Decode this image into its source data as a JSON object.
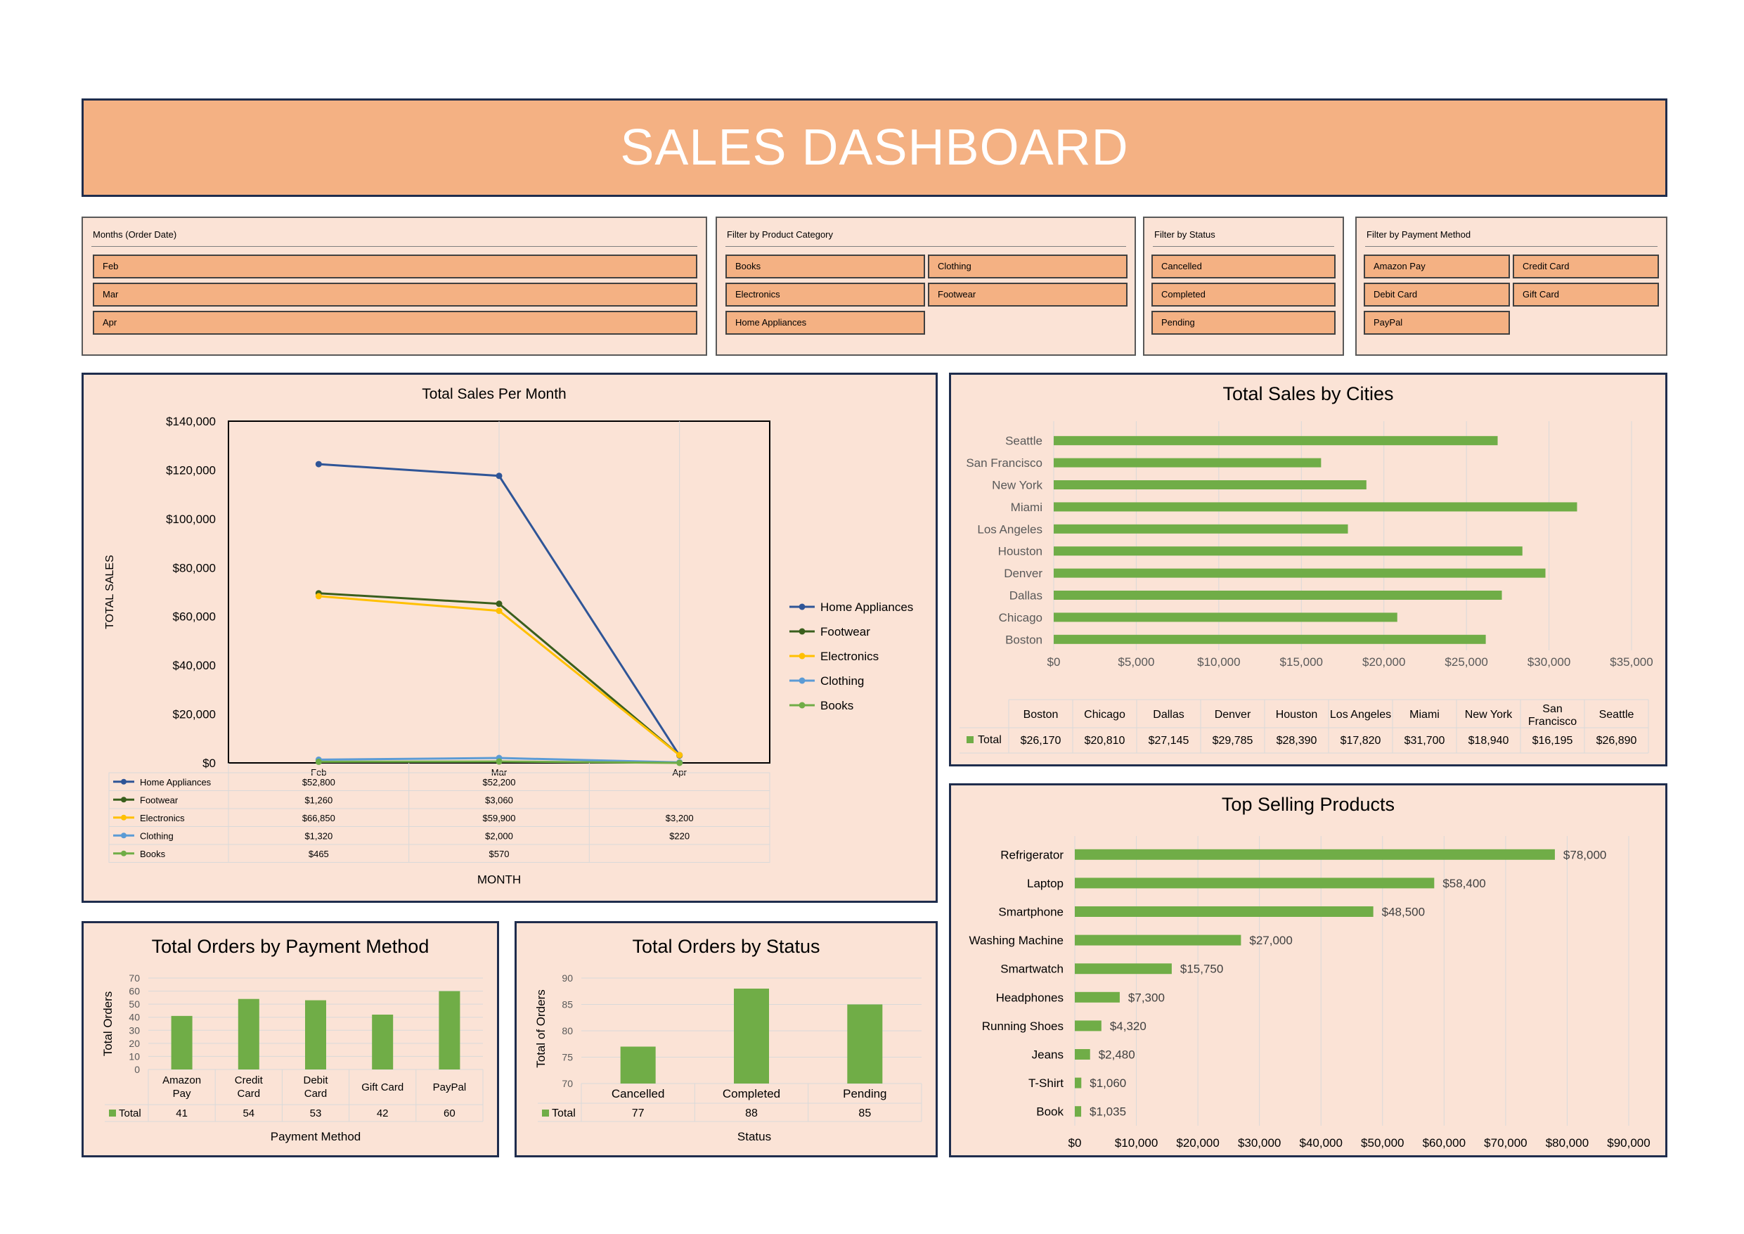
{
  "title": "SALES DASHBOARD",
  "colors": {
    "banner": "#f4b183",
    "panel_bg": "#fbe3d6",
    "panel_border": "#1f2d4d",
    "bar_green": "#70ad47"
  },
  "slicers": {
    "months": {
      "label": "Months (Order Date)",
      "items": [
        "Feb",
        "Mar",
        "Apr"
      ]
    },
    "category": {
      "label": "Filter by Product Category",
      "items": [
        "Books",
        "Clothing",
        "Electronics",
        "Footwear",
        "Home Appliances"
      ]
    },
    "status": {
      "label": "Filter by Status",
      "items": [
        "Cancelled",
        "Completed",
        "Pending"
      ]
    },
    "payment": {
      "label": "Filter by Payment Method",
      "items": [
        "Amazon Pay",
        "Credit Card",
        "Debit Card",
        "Gift Card",
        "PayPal"
      ]
    }
  },
  "chart_data": [
    {
      "type": "line",
      "title": "Total Sales Per Month",
      "xlabel": "MONTH",
      "ylabel": "TOTAL SALES",
      "categories": [
        "Feb",
        "Mar",
        "Apr"
      ],
      "ylim": [
        0,
        140000
      ],
      "yticks": [
        "$0",
        "$20,000",
        "$40,000",
        "$60,000",
        "$80,000",
        "$100,000",
        "$120,000",
        "$140,000"
      ],
      "legend_position": "right",
      "series": [
        {
          "name": "Home Appliances",
          "color": "#2f5597",
          "values": [
            122400,
            117600,
            3000
          ],
          "labels": [
            "$52,800",
            "$52,200",
            ""
          ]
        },
        {
          "name": "Footwear",
          "color": "#3a5f1d",
          "values": [
            69500,
            65200,
            3200
          ],
          "labels": [
            "$1,260",
            "$3,060",
            ""
          ]
        },
        {
          "name": "Electronics",
          "color": "#ffc000",
          "values": [
            68300,
            62300,
            3200
          ],
          "labels": [
            "$66,850",
            "$59,900",
            "$3,200"
          ]
        },
        {
          "name": "Clothing",
          "color": "#5b9bd5",
          "values": [
            1320,
            2000,
            220
          ],
          "labels": [
            "$1,320",
            "$2,000",
            "$220"
          ]
        },
        {
          "name": "Books",
          "color": "#70ad47",
          "values": [
            465,
            570,
            0
          ],
          "labels": [
            "$465",
            "$570",
            ""
          ]
        }
      ]
    },
    {
      "type": "bar",
      "orientation": "horizontal",
      "title": "Total Sales by Cities",
      "categories": [
        "Boston",
        "Chicago",
        "Dallas",
        "Denver",
        "Houston",
        "Los Angeles",
        "Miami",
        "New York",
        "San Francisco",
        "Seattle"
      ],
      "table_headers": [
        "Boston",
        "Chicago",
        "Dallas",
        "Denver",
        "Houston",
        "Los Angeles",
        "Miami",
        "New York",
        "San Francisco",
        "Seattle"
      ],
      "series": [
        {
          "name": "Total",
          "values": [
            26170,
            20810,
            27145,
            29785,
            28390,
            17820,
            31700,
            18940,
            16195,
            26890
          ]
        }
      ],
      "value_labels": [
        "$26,170",
        "$20,810",
        "$27,145",
        "$29,785",
        "$28,390",
        "$17,820",
        "$31,700",
        "$18,940",
        "$16,195",
        "$26,890"
      ],
      "xlim": [
        0,
        35000
      ],
      "xticks": [
        "$0",
        "$5,000",
        "$10,000",
        "$15,000",
        "$20,000",
        "$25,000",
        "$30,000",
        "$35,000"
      ]
    },
    {
      "type": "bar",
      "orientation": "horizontal",
      "title": "Top Selling Products",
      "categories": [
        "Refrigerator",
        "Laptop",
        "Smartphone",
        "Washing Machine",
        "Smartwatch",
        "Headphones",
        "Running Shoes",
        "Jeans",
        "T-Shirt",
        "Book"
      ],
      "values": [
        78000,
        58400,
        48500,
        27000,
        15750,
        7300,
        4320,
        2480,
        1060,
        1035
      ],
      "value_labels": [
        "$78,000",
        "$58,400",
        "$48,500",
        "$27,000",
        "$15,750",
        "$7,300",
        "$4,320",
        "$2,480",
        "$1,060",
        "$1,035"
      ],
      "xlim": [
        0,
        90000
      ],
      "xticks": [
        "$0",
        "$10,000",
        "$20,000",
        "$30,000",
        "$40,000",
        "$50,000",
        "$60,000",
        "$70,000",
        "$80,000",
        "$90,000"
      ]
    },
    {
      "type": "bar",
      "title": "Total Orders by Payment Method",
      "xlabel": "Payment Method",
      "ylabel": "Total Orders",
      "categories": [
        "Amazon Pay",
        "Credit Card",
        "Debit Card",
        "Gift Card",
        "PayPal"
      ],
      "series": [
        {
          "name": "Total",
          "values": [
            41,
            54,
            53,
            42,
            60
          ]
        }
      ],
      "ylim": [
        0,
        70
      ],
      "yticks": [
        "0",
        "10",
        "20",
        "30",
        "40",
        "50",
        "60",
        "70"
      ]
    },
    {
      "type": "bar",
      "title": "Total Orders by Status",
      "xlabel": "Status",
      "ylabel": "Total of Orders",
      "categories": [
        "Cancelled",
        "Completed",
        "Pending"
      ],
      "series": [
        {
          "name": "Total",
          "values": [
            77,
            88,
            85
          ]
        }
      ],
      "ylim": [
        70,
        90
      ],
      "yticks": [
        "70",
        "75",
        "80",
        "85",
        "90"
      ]
    }
  ]
}
